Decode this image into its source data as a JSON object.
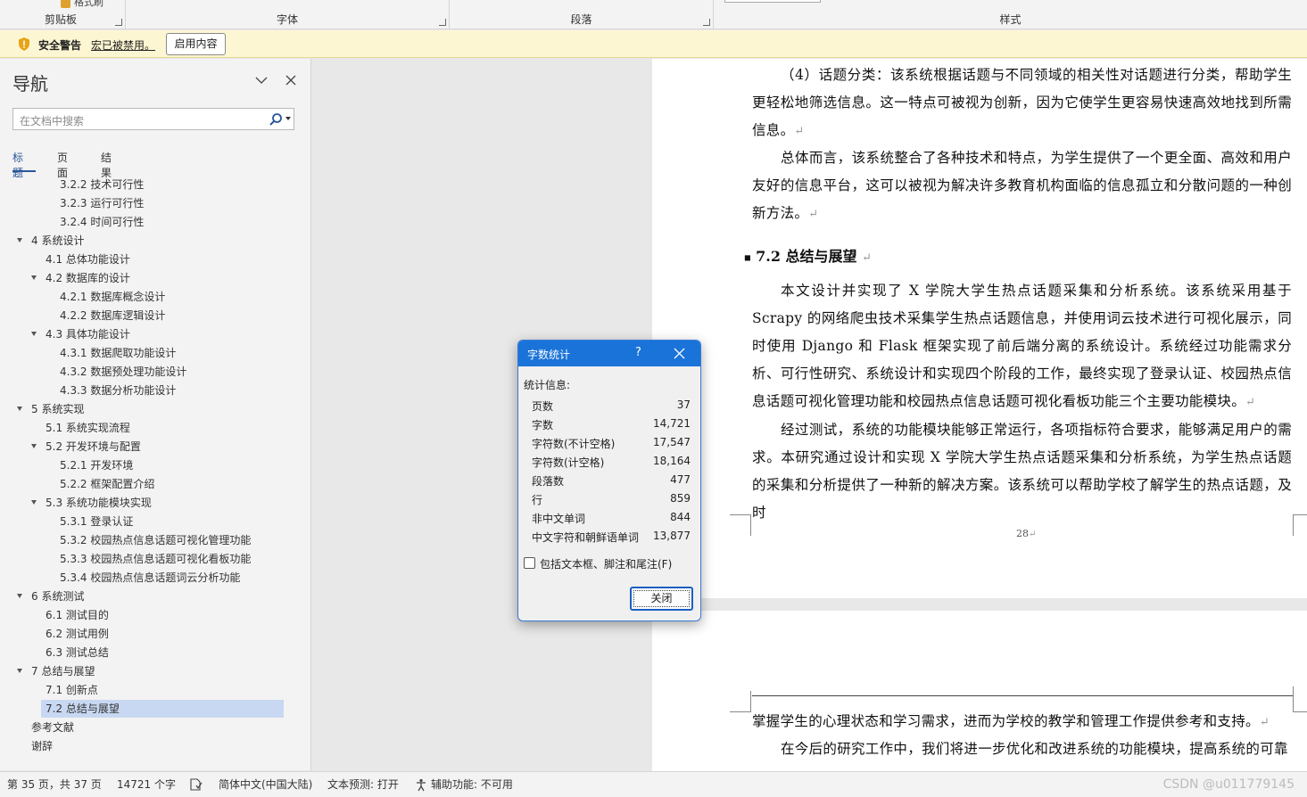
{
  "ribbon": {
    "format_painter_label": "格式刷",
    "groups": [
      {
        "label": "剪贴板"
      },
      {
        "label": "字体"
      },
      {
        "label": "段落"
      },
      {
        "label": "样式"
      }
    ]
  },
  "security_bar": {
    "title": "安全警告",
    "message": "宏已被禁用。",
    "button": "启用内容"
  },
  "nav": {
    "title": "导航",
    "search_placeholder": "在文档中搜索",
    "tabs": [
      "标题",
      "页面",
      "结果"
    ],
    "active_tab": "标题",
    "items": [
      {
        "label": "3.2.2 技术可行性",
        "level": 3,
        "expandable": false
      },
      {
        "label": "3.2.3 运行可行性",
        "level": 3,
        "expandable": false
      },
      {
        "label": "3.2.4 时间可行性",
        "level": 3,
        "expandable": false
      },
      {
        "label": "4 系统设计",
        "level": 1,
        "expandable": true
      },
      {
        "label": "4.1 总体功能设计",
        "level": 2,
        "expandable": false
      },
      {
        "label": "4.2 数据库的设计",
        "level": 2,
        "expandable": true
      },
      {
        "label": "4.2.1 数据库概念设计",
        "level": 3,
        "expandable": false
      },
      {
        "label": "4.2.2 数据库逻辑设计",
        "level": 3,
        "expandable": false
      },
      {
        "label": "4.3 具体功能设计",
        "level": 2,
        "expandable": true
      },
      {
        "label": "4.3.1 数据爬取功能设计",
        "level": 3,
        "expandable": false
      },
      {
        "label": "4.3.2 数据预处理功能设计",
        "level": 3,
        "expandable": false
      },
      {
        "label": "4.3.3 数据分析功能设计",
        "level": 3,
        "expandable": false
      },
      {
        "label": "5 系统实现",
        "level": 1,
        "expandable": true
      },
      {
        "label": "5.1 系统实现流程",
        "level": 2,
        "expandable": false
      },
      {
        "label": "5.2 开发环境与配置",
        "level": 2,
        "expandable": true
      },
      {
        "label": "5.2.1 开发环境",
        "level": 3,
        "expandable": false
      },
      {
        "label": "5.2.2 框架配置介绍",
        "level": 3,
        "expandable": false
      },
      {
        "label": "5.3 系统功能模块实现",
        "level": 2,
        "expandable": true
      },
      {
        "label": "5.3.1 登录认证",
        "level": 3,
        "expandable": false
      },
      {
        "label": "5.3.2 校园热点信息话题可视化管理功能",
        "level": 3,
        "expandable": false
      },
      {
        "label": "5.3.3 校园热点信息话题可视化看板功能",
        "level": 3,
        "expandable": false
      },
      {
        "label": "5.3.4 校园热点信息话题词云分析功能",
        "level": 3,
        "expandable": false
      },
      {
        "label": "6 系统测试",
        "level": 1,
        "expandable": true
      },
      {
        "label": "6.1 测试目的",
        "level": 2,
        "expandable": false
      },
      {
        "label": "6.2 测试用例",
        "level": 2,
        "expandable": false
      },
      {
        "label": "6.3 测试总结",
        "level": 2,
        "expandable": false
      },
      {
        "label": "7 总结与展望",
        "level": 1,
        "expandable": true
      },
      {
        "label": "7.1 创新点",
        "level": 2,
        "expandable": false
      },
      {
        "label": "7.2 总结与展望",
        "level": 2,
        "expandable": false,
        "selected": true
      },
      {
        "label": "参考文献",
        "level": 1,
        "expandable": false
      },
      {
        "label": "谢辞",
        "level": 1,
        "expandable": false
      }
    ]
  },
  "document": {
    "para1": "（4）话题分类：该系统根据话题与不同领域的相关性对话题进行分类，帮助学生更轻松地筛选信息。这一特点可被视为创新，因为它使学生更容易快速高效地找到所需信息。",
    "para2": "总体而言，该系统整合了各种技术和特点，为学生提供了一个更全面、高效和用户友好的信息平台，这可以被视为解决许多教育机构面临的信息孤立和分散问题的一种创新方法。",
    "heading": "7.2  总结与展望",
    "para3": "本文设计并实现了 X 学院大学生热点话题采集和分析系统。该系统采用基于 Scrapy 的网络爬虫技术采集学生热点话题信息，并使用词云技术进行可视化展示，同时使用 Django 和 Flask 框架实现了前后端分离的系统设计。系统经过功能需求分析、可行性研究、系统设计和实现四个阶段的工作，最终实现了登录认证、校园热点信息话题可视化管理功能和校园热点信息话题可视化看板功能三个主要功能模块。",
    "para4": "经过测试，系统的功能模块能够正常运行，各项指标符合要求，能够满足用户的需求。本研究通过设计和实现 X 学院大学生热点话题采集和分析系统，为学生热点话题的采集和分析提供了一种新的解决方案。该系统可以帮助学校了解学生的热点话题，及时",
    "page_number": "28",
    "para5": "掌握学生的心理状态和学习需求，进而为学校的教学和管理工作提供参考和支持。",
    "para6": "在今后的研究工作中，我们将进一步优化和改进系统的功能模块，提高系统的可靠"
  },
  "dialog": {
    "title": "字数统计",
    "help": "?",
    "section_label": "统计信息:",
    "stats": [
      {
        "label": "页数",
        "value": "37"
      },
      {
        "label": "字数",
        "value": "14,721"
      },
      {
        "label": "字符数(不计空格)",
        "value": "17,547"
      },
      {
        "label": "字符数(计空格)",
        "value": "18,164"
      },
      {
        "label": "段落数",
        "value": "477"
      },
      {
        "label": "行",
        "value": "859"
      },
      {
        "label": "非中文单词",
        "value": "844"
      },
      {
        "label": "中文字符和朝鲜语单词",
        "value": "13,877"
      }
    ],
    "checkbox_label": "包括文本框、脚注和尾注(F)",
    "checkbox_checked": false,
    "close_button": "关闭"
  },
  "status_bar": {
    "page": "第 35 页，共 37 页",
    "words": "14721 个字",
    "language": "简体中文(中国大陆)",
    "prediction": "文本预测: 打开",
    "accessibility": "辅助功能: 不可用",
    "watermark": "CSDN @u011779145"
  },
  "colors": {
    "accent": "#2b579a",
    "dialog_title": "#1a73d9",
    "security_bar": "#fdf6d2",
    "nav_selection": "#c8d8f2"
  }
}
